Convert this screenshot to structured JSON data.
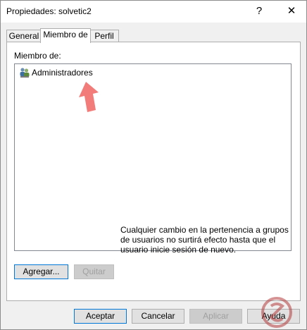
{
  "window": {
    "title": "Propiedades: solvetic2",
    "help_glyph": "?",
    "close_glyph": "✕"
  },
  "tabs": [
    {
      "label": "General"
    },
    {
      "label": "Miembro de"
    },
    {
      "label": "Perfil"
    }
  ],
  "panel": {
    "member_label": "Miembro de:",
    "members": [
      {
        "name": "Administradores",
        "icon": "user-group-icon"
      }
    ],
    "add_button": "Agregar...",
    "remove_button": "Quitar",
    "note": "Cualquier cambio en la pertenencia a grupos de usuarios no surtirá efecto hasta que el usuario inicie sesión de nuevo."
  },
  "footer": {
    "accept": "Aceptar",
    "cancel": "Cancelar",
    "apply": "Aplicar",
    "help": "Ayuda"
  },
  "colors": {
    "accent": "#0078d7",
    "arrow": "#f27c79",
    "logo": "#b33a3a"
  }
}
